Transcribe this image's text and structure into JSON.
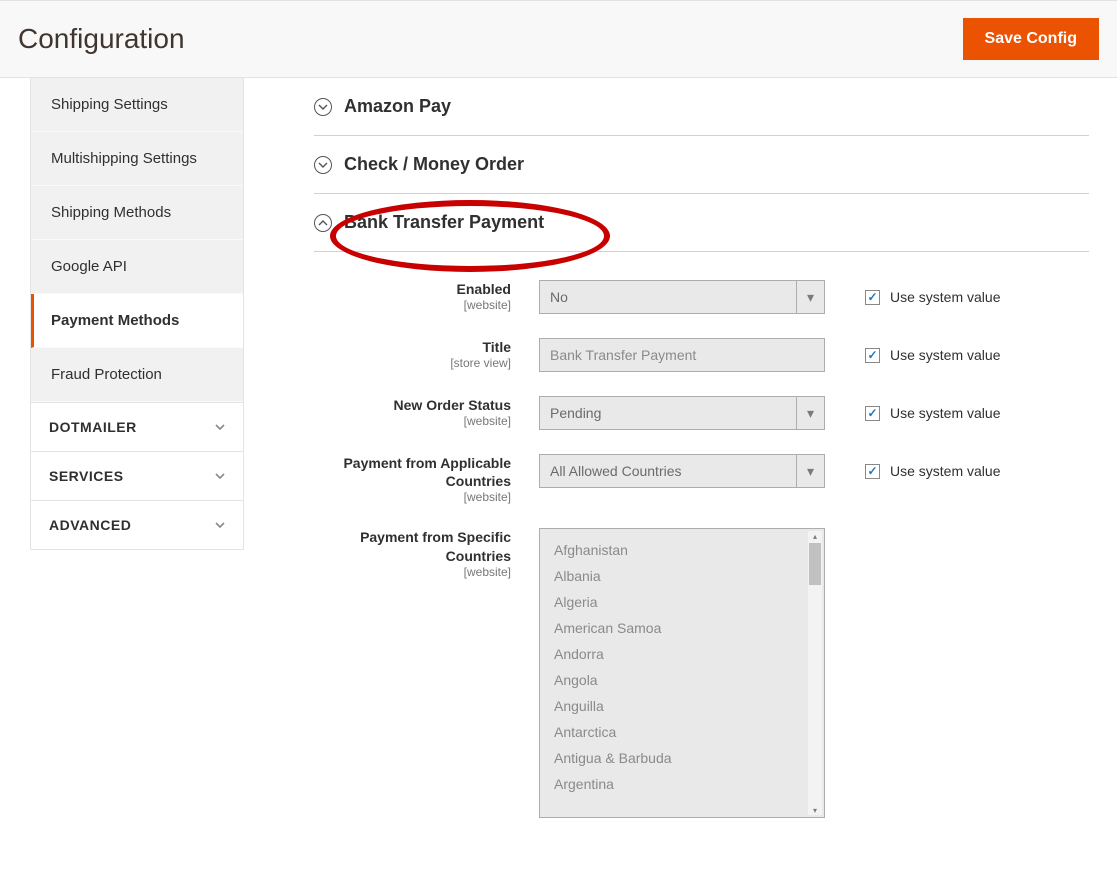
{
  "header": {
    "title": "Configuration",
    "save_button": "Save Config"
  },
  "sidebar": {
    "items": [
      "Shipping Settings",
      "Multishipping Settings",
      "Shipping Methods",
      "Google API",
      "Payment Methods",
      "Fraud Protection"
    ],
    "active_index": 4,
    "groups": [
      "DOTMAILER",
      "SERVICES",
      "ADVANCED"
    ]
  },
  "sections": {
    "amazon_pay": {
      "title": "Amazon Pay",
      "expanded": false
    },
    "check_money": {
      "title": "Check / Money Order",
      "expanded": false
    },
    "bank_transfer": {
      "title": "Bank Transfer Payment",
      "expanded": true
    }
  },
  "use_system_value_label": "Use system value",
  "scopes": {
    "website": "[website]",
    "store_view": "[store view]"
  },
  "bank_transfer_fields": {
    "enabled": {
      "label": "Enabled",
      "scope": "website",
      "value": "No",
      "use_system": true,
      "type": "select"
    },
    "title": {
      "label": "Title",
      "scope": "store_view",
      "value": "Bank Transfer Payment",
      "use_system": true,
      "type": "text"
    },
    "new_order_status": {
      "label": "New Order Status",
      "scope": "website",
      "value": "Pending",
      "use_system": true,
      "type": "select"
    },
    "applicable_countries": {
      "label": "Payment from Applicable Countries",
      "scope": "website",
      "value": "All Allowed Countries",
      "use_system": true,
      "type": "select"
    },
    "specific_countries": {
      "label": "Payment from Specific Countries",
      "scope": "website",
      "type": "multiselect",
      "options": [
        "Afghanistan",
        "Albania",
        "Algeria",
        "American Samoa",
        "Andorra",
        "Angola",
        "Anguilla",
        "Antarctica",
        "Antigua & Barbuda",
        "Argentina"
      ]
    }
  }
}
